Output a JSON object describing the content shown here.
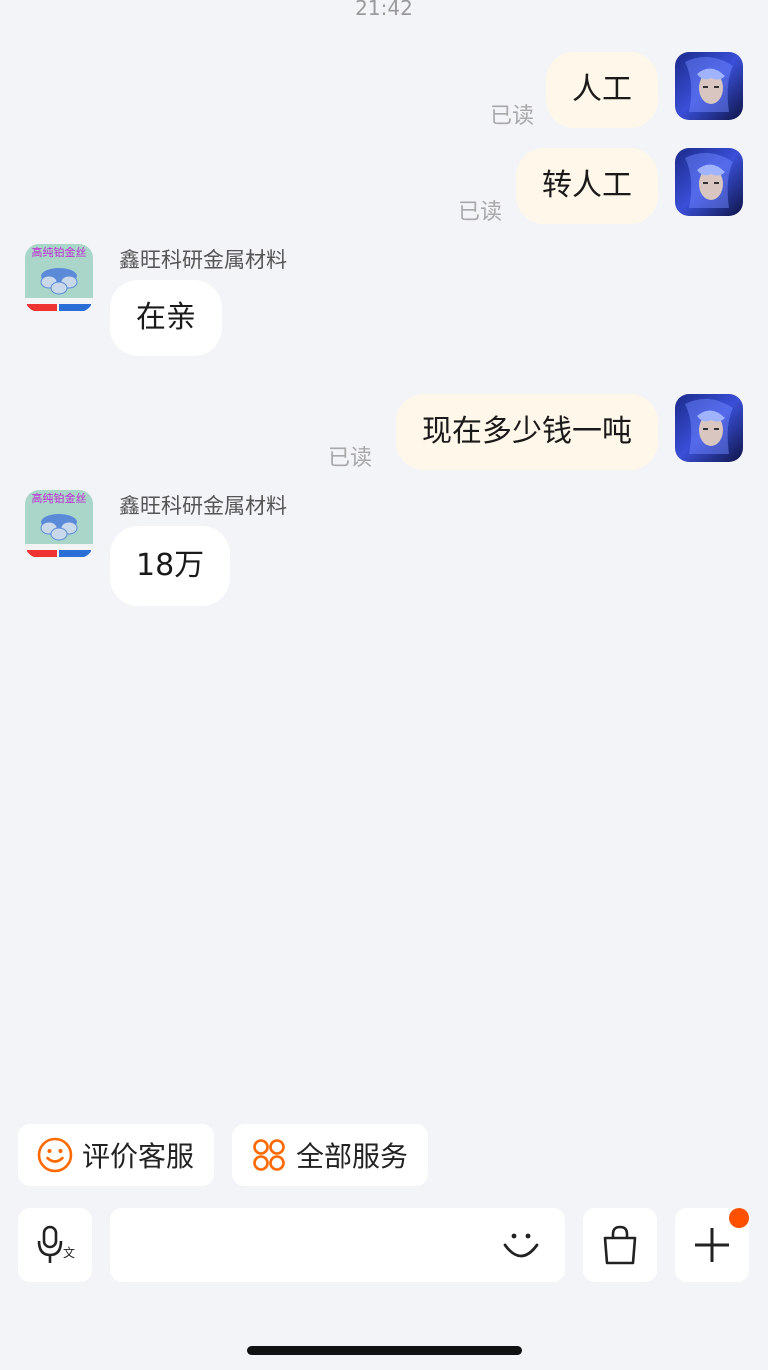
{
  "status_time": "21:42",
  "shop": {
    "name": "鑫旺科研金属材料",
    "avatar_text": "高纯铂金丝",
    "avatar_accent": "#c026d3"
  },
  "messages": [
    {
      "from": "user",
      "text": "人工",
      "status": "已读"
    },
    {
      "from": "user",
      "text": "转人工",
      "status": "已读"
    },
    {
      "from": "shop",
      "text": "在亲"
    },
    {
      "from": "user",
      "text": "现在多少钱一吨",
      "status": "已读"
    },
    {
      "from": "shop",
      "text": "18万"
    }
  ],
  "quick_actions": [
    {
      "label": "评价客服",
      "icon": "smiley-icon"
    },
    {
      "label": "全部服务",
      "icon": "grid-circles-icon"
    }
  ],
  "toolbar": {
    "voice_icon": "mic-translate-icon",
    "emoji_icon": "smiley-icon",
    "shop_icon": "shopping-bag-icon",
    "more_icon": "plus-icon",
    "badge_color": "#ff5000"
  },
  "colors": {
    "background": "#f3f4f8",
    "outgoing_bubble": "#fff8ea",
    "incoming_bubble": "#ffffff",
    "accent": "#ff6a00"
  }
}
